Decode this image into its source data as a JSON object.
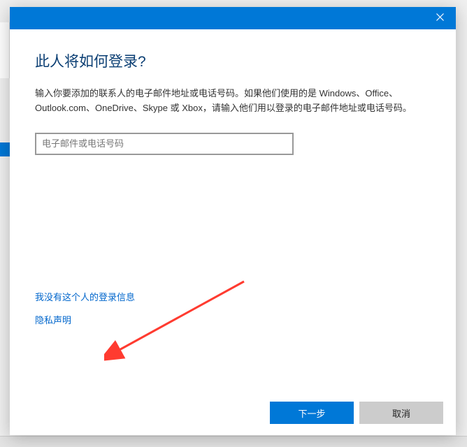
{
  "dialog": {
    "heading": "此人将如何登录?",
    "description": "输入你要添加的联系人的电子邮件地址或电话号码。如果他们使用的是 Windows、Office、Outlook.com、OneDrive、Skype 或 Xbox，请输入他们用以登录的电子邮件地址或电话号码。",
    "input_placeholder": "电子邮件或电话号码",
    "links": {
      "no_info": "我没有这个人的登录信息",
      "privacy": "隐私声明"
    },
    "buttons": {
      "next": "下一步",
      "cancel": "取消"
    }
  }
}
